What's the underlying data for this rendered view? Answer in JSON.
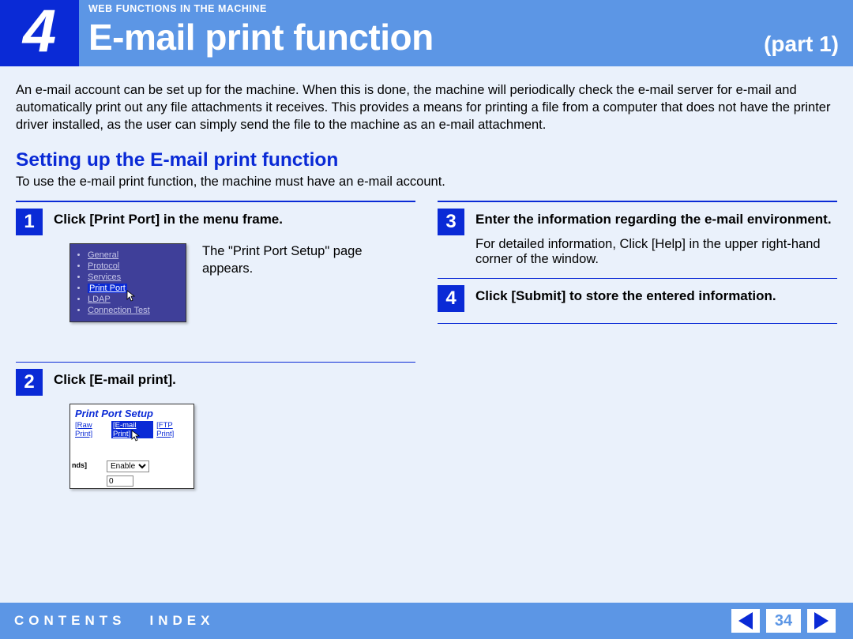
{
  "header": {
    "chapter_number": "4",
    "supertitle": "WEB FUNCTIONS IN THE MACHINE",
    "title": "E-mail print function",
    "part_label": "(part 1)"
  },
  "intro": "An e-mail account can be set up for the machine. When this is done, the machine will periodically check the e-mail server for e-mail and automatically print out any file attachments it receives. This provides a means for printing a file from a computer that does not have the printer driver installed, as the user can simply send the file to the machine as an e-mail attachment.",
  "section": {
    "title": "Setting up the E-mail print function",
    "desc": "To use the e-mail print function, the machine must have an e-mail account."
  },
  "steps": {
    "s1": {
      "num": "1",
      "title": "Click [Print Port] in the menu frame.",
      "body": "The \"Print Port Setup\" page appears."
    },
    "s2": {
      "num": "2",
      "title": "Click [E-mail print]."
    },
    "s3": {
      "num": "3",
      "title": "Enter the information regarding the e-mail environment.",
      "body": "For detailed information, Click [Help] in the upper right-hand corner of the window."
    },
    "s4": {
      "num": "4",
      "title": "Click [Submit] to store the entered information."
    }
  },
  "shot1": {
    "items": [
      "General",
      "Protocol",
      "Services",
      "Print Port",
      "LDAP",
      "Connection Test"
    ],
    "highlight_index": 3
  },
  "shot2": {
    "title": "Print Port Setup",
    "tabs": [
      "[Raw Print]",
      "[E-mail Print]",
      "[FTP Print]"
    ],
    "selected_tab_index": 1,
    "enable_label": "Enable",
    "num_value": "0",
    "nds_label": "nds]"
  },
  "footer": {
    "contents_label": "CONTENTS",
    "index_label": "INDEX",
    "page_number": "34"
  }
}
